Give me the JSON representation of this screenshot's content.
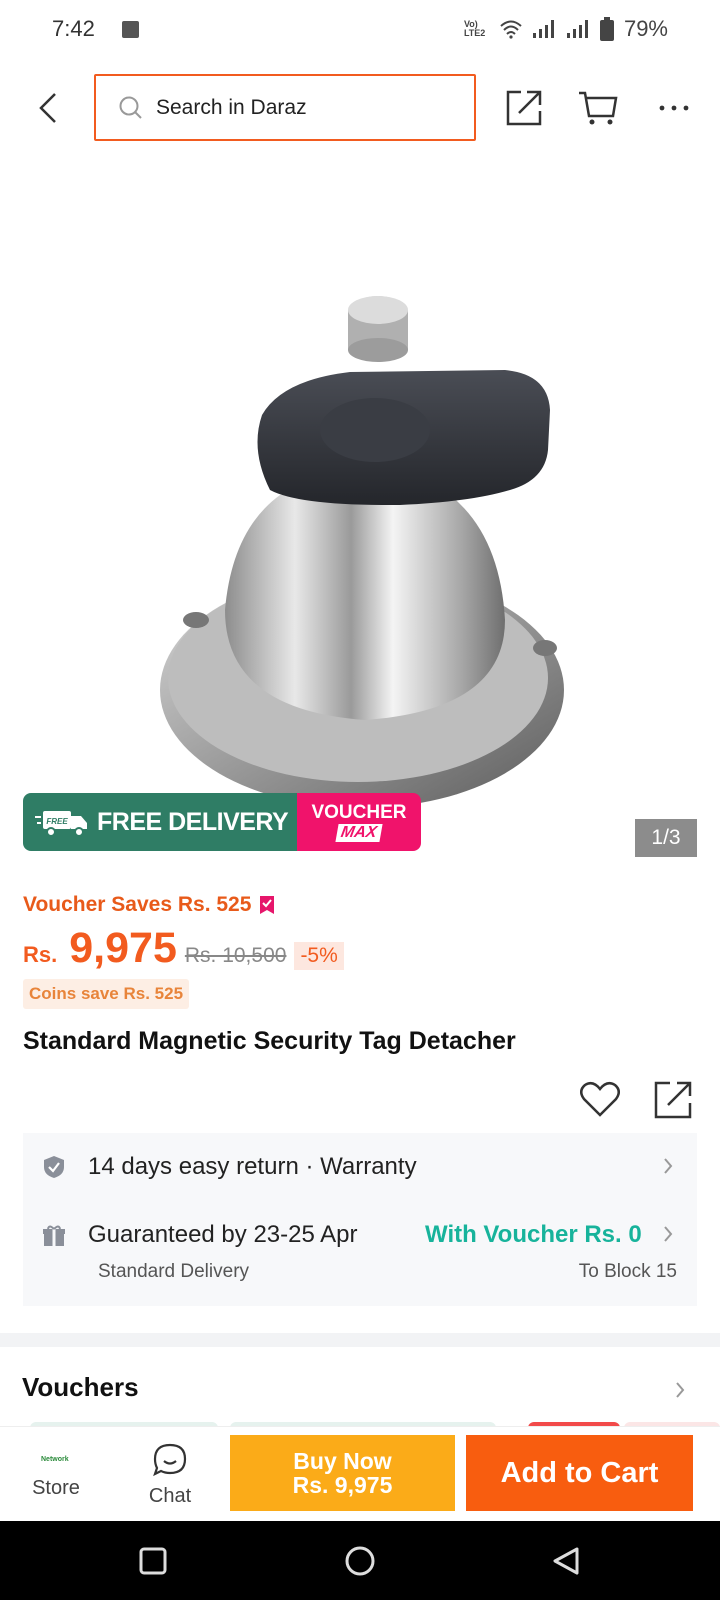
{
  "status_bar": {
    "time": "7:42",
    "network_label": "Vo) LTE2",
    "battery": "79%"
  },
  "header": {
    "search_placeholder": "Search in Daraz",
    "icons": [
      "back-arrow-icon",
      "share-icon",
      "cart-icon",
      "more-icon"
    ]
  },
  "gallery": {
    "counter": "1/3",
    "badge_free_small": "FREE",
    "badge_free_delivery": "FREE DELIVERY",
    "badge_voucher_top": "VOUCHER",
    "badge_voucher_bottom": "MAX"
  },
  "price": {
    "voucher_saves": "Voucher Saves Rs. 525",
    "currency": "Rs.",
    "current": "9,975",
    "original": "Rs. 10,500",
    "discount": "-5%",
    "coins_save": "Coins save Rs. 525"
  },
  "product": {
    "title": "Standard Magnetic Security Tag Detacher"
  },
  "service": {
    "return_text": "14 days easy return  ·  Warranty",
    "guarantee": "Guaranteed by 23-25 Apr",
    "voucher_delivery": "With Voucher Rs. 0",
    "delivery_type": "Standard Delivery",
    "destination": "To Block 15"
  },
  "vouchers": {
    "title": "Vouchers"
  },
  "actions": {
    "store_label": "Store",
    "store_logo_text": "Network",
    "chat_label": "Chat",
    "buy_now_line1": "Buy Now",
    "buy_now_line2": "Rs. 9,975",
    "add_to_cart": "Add to Cart"
  },
  "colors": {
    "brand_orange": "#f85d0f",
    "buy_yellow": "#fbab18",
    "free_delivery_green": "#2f7d65",
    "voucher_pink": "#f0136b",
    "teal": "#17b39b"
  }
}
